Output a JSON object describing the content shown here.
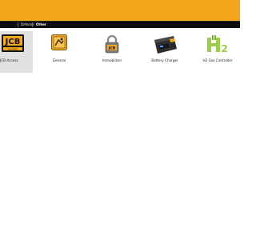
{
  "tabs": [
    {
      "label": ""
    },
    {
      "label": "Defense"
    },
    {
      "label": "Other"
    }
  ],
  "tiles": [
    {
      "label": "JCB Access",
      "icon": "jcb-access-icon"
    },
    {
      "label": "General",
      "icon": "general-icon"
    },
    {
      "label": "Immobiliser",
      "icon": "immobiliser-icon"
    },
    {
      "label": "Battery Charger",
      "icon": "battery-charger-icon"
    },
    {
      "label": "H2 Gas Controller",
      "icon": "h2-gas-controller-icon"
    }
  ],
  "colors": {
    "banner": "#f5a71b",
    "tabbar": "#0d0d0d",
    "selected_tile": "#e1e1e1",
    "h2_green": "#9acd4a"
  }
}
